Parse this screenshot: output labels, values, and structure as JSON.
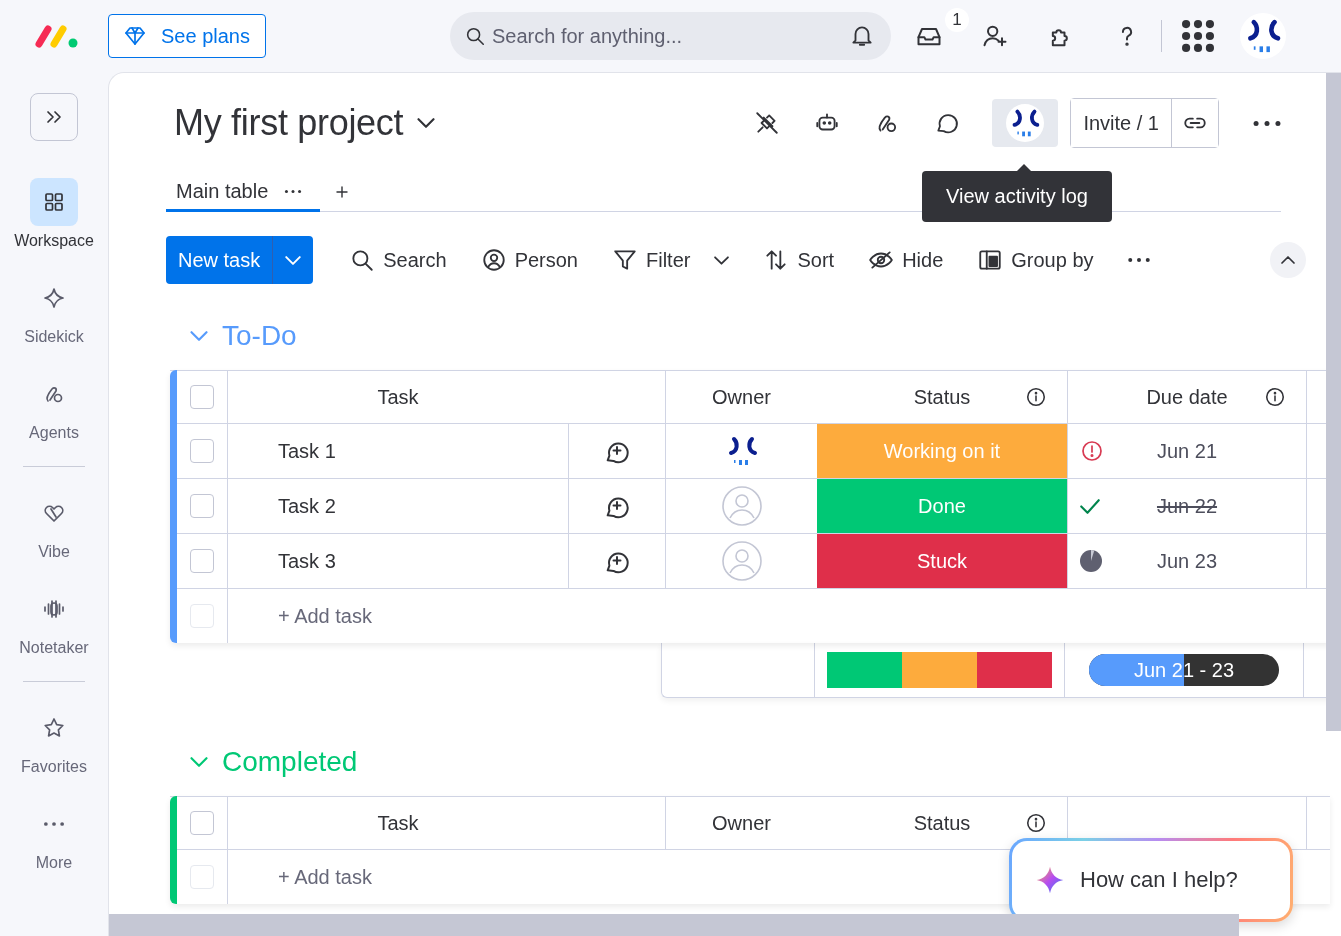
{
  "topbar": {
    "plans_button": "See plans",
    "search": {
      "placeholder": "Search for anything..."
    },
    "inbox_badge": "1"
  },
  "sidebar": {
    "sections": [
      [
        {
          "label": "Workspace",
          "kind": "grid",
          "selected": true
        },
        {
          "label": "Sidekick",
          "kind": "sparkle",
          "selected": false
        },
        {
          "label": "Agents",
          "kind": "agent",
          "selected": false
        }
      ],
      [
        {
          "label": "Vibe",
          "kind": "heart",
          "selected": false
        },
        {
          "label": "Notetaker",
          "kind": "wave",
          "selected": false
        }
      ],
      [
        {
          "label": "Favorites",
          "kind": "star",
          "selected": false
        },
        {
          "label": "More",
          "kind": "dots",
          "selected": false
        }
      ]
    ]
  },
  "board": {
    "title": "My first project",
    "invite": "Invite / 1",
    "tooltip": "View activity log",
    "tabs": [
      {
        "label": "Main table",
        "selected": true
      }
    ],
    "new_task": "New task",
    "actions": [
      {
        "kind": "search",
        "label": "Search",
        "dropdown": false
      },
      {
        "kind": "person",
        "label": "Person",
        "dropdown": false
      },
      {
        "kind": "filter",
        "label": "Filter",
        "dropdown": true
      },
      {
        "kind": "sort",
        "label": "Sort",
        "dropdown": false
      },
      {
        "kind": "hide",
        "label": "Hide",
        "dropdown": false
      },
      {
        "kind": "group",
        "label": "Group by",
        "dropdown": false
      }
    ]
  },
  "groups": [
    {
      "title": "To-Do",
      "color": "#579bfc",
      "expanded": true,
      "select_all_checked": false,
      "columns": [
        {
          "label": "Task",
          "info": false
        },
        {
          "label": "Owner",
          "info": false
        },
        {
          "label": "Status",
          "info": true
        },
        {
          "label": "Due date",
          "info": true
        }
      ],
      "rows": [
        {
          "task": "Task 1",
          "checked": false,
          "owner": {
            "kind": "logo"
          },
          "status": "Working on it",
          "color": "#fdab3d",
          "due": {
            "text": "Jun 21",
            "kind": "overdue"
          }
        },
        {
          "task": "Task 2",
          "checked": false,
          "owner": {
            "kind": "empty"
          },
          "status": "Done",
          "color": "#00c875",
          "due": {
            "text": "Jun 22",
            "kind": "done"
          }
        },
        {
          "task": "Task 3",
          "checked": false,
          "owner": {
            "kind": "empty"
          },
          "status": "Stuck",
          "color": "#df2f4a",
          "due": {
            "text": "Jun 23",
            "kind": "pending"
          }
        }
      ],
      "add_row": {
        "label": "+ Add task",
        "disabled": true
      },
      "summary": {
        "segments": [
          {
            "color": "#00c875"
          },
          {
            "color": "#fdab3d"
          },
          {
            "color": "#df2f4a"
          }
        ],
        "timeline": {
          "text": "Jun 21 - 23",
          "level": 0.5
        }
      }
    },
    {
      "title": "Completed",
      "color": "#00c875",
      "expanded": true,
      "select_all_checked": false,
      "columns": [
        {
          "label": "Task",
          "info": false
        },
        {
          "label": "Owner",
          "info": false
        },
        {
          "label": "Status",
          "info": true
        }
      ],
      "add_row": {
        "label": "+ Add task",
        "disabled": true
      }
    }
  ],
  "assistant": {
    "prompt": "How can I help?"
  }
}
